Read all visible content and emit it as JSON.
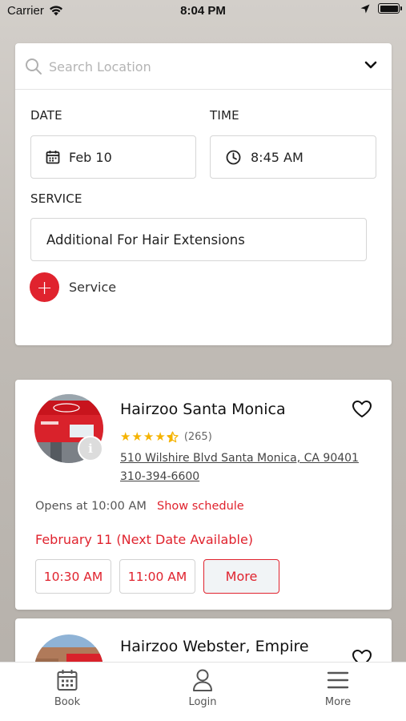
{
  "status_bar": {
    "carrier": "Carrier",
    "time": "8:04 PM"
  },
  "search": {
    "placeholder": "Search Location",
    "value": ""
  },
  "date": {
    "label": "DATE",
    "value": "Feb 10"
  },
  "time": {
    "label": "TIME",
    "value": "8:45 AM"
  },
  "service": {
    "label": "SERVICE",
    "value": "Additional For Hair Extensions",
    "add_label": "Service"
  },
  "salons": [
    {
      "name": "Hairzoo Santa Monica",
      "rating": 4.5,
      "rating_count": "(265)",
      "address": "510 Wilshire Blvd Santa Monica, CA 90401",
      "phone": "310-394-6600",
      "opens": "Opens at 10:00 AM",
      "schedule_link": "Show schedule",
      "next_date": "February 11 (Next Date Available)",
      "slots": [
        "10:30 AM",
        "11:00 AM"
      ],
      "more_label": "More",
      "favorited": false
    },
    {
      "name": "Hairzoo Webster, Empire",
      "favorited": false
    }
  ],
  "tabs": [
    {
      "label": "Book",
      "icon": "calendar-icon"
    },
    {
      "label": "Login",
      "icon": "user-icon"
    },
    {
      "label": "More",
      "icon": "menu-icon"
    }
  ],
  "colors": {
    "accent": "#e0232e",
    "star": "#f5b301"
  }
}
